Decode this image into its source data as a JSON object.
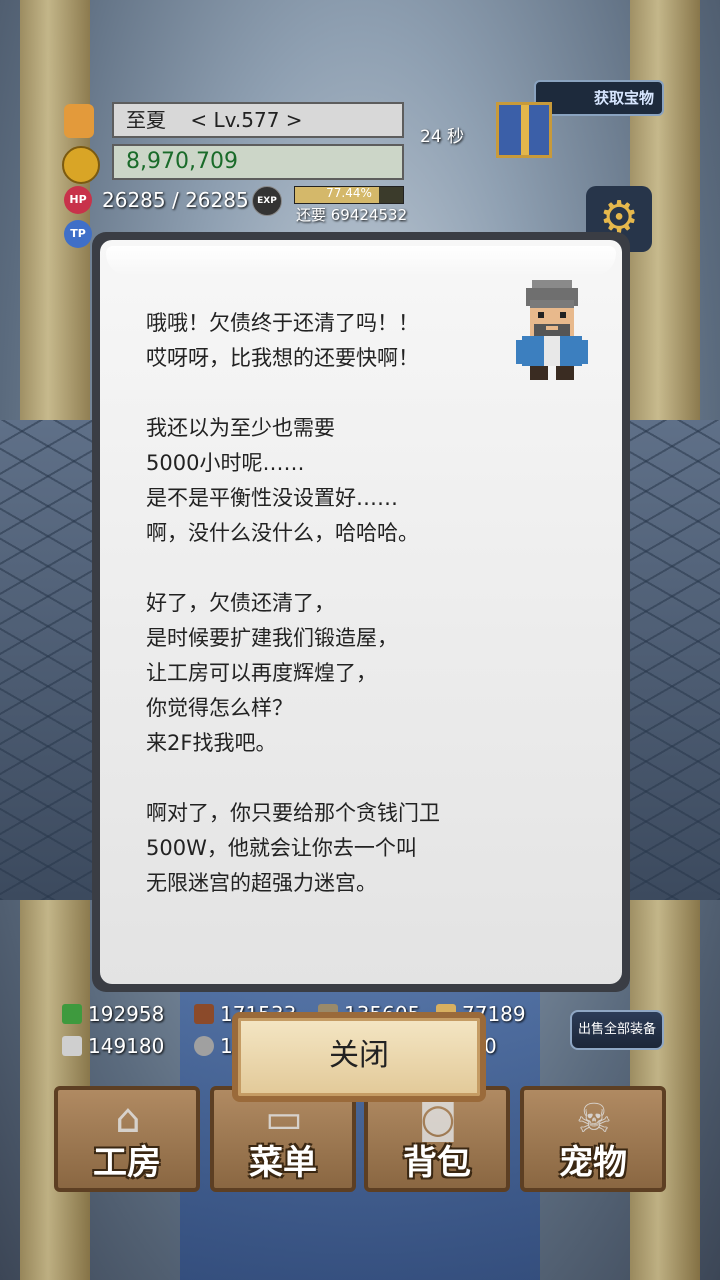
{
  "player": {
    "name": "至夏",
    "level": "< Lv.577 >",
    "gold": "8,970,709"
  },
  "stats": {
    "hp_label": "HP",
    "hp": "26285 / 26285",
    "tp_label": "TP",
    "exp_label": "EXP",
    "exp_percent": "77.44%",
    "exp_fraction": 0.7744,
    "exp_remaining": "还要 69424532"
  },
  "timer": "24 秒",
  "get_gift_label": "获取宝物",
  "dialog": {
    "paragraphs": [
      [
        "哦哦！欠债终于还清了吗！！",
        "哎呀呀，比我想的还要快啊！"
      ],
      [
        "我还以为至少也需要",
        "5000小时呢……",
        "是不是平衡性没设置好……",
        "啊，没什么没什么，哈哈哈。"
      ],
      [
        "好了，欠债还清了，",
        "是时候要扩建我们锻造屋，",
        "让工房可以再度辉煌了，",
        "你觉得怎么样？",
        "来2F找我吧。"
      ],
      [
        "啊对了，你只要给那个贪钱门卫",
        "500W，他就会让你去一个叫",
        "无限迷宫的超强力迷宫。"
      ]
    ]
  },
  "resources": {
    "herb": "192958",
    "wood": "171533",
    "ore": "135605",
    "gem": "77189",
    "iron": "149180",
    "stone": "1",
    "extra": "0"
  },
  "sell_all_label": "出售全部装备",
  "close_label": "关闭",
  "nav": [
    {
      "label": "工房"
    },
    {
      "label": "菜单"
    },
    {
      "label": "背包"
    },
    {
      "label": "宠物"
    }
  ],
  "colors": {
    "gold_text": "#1a6b2a",
    "exp_fill": "#d4b86a",
    "button_frame": "#9a6a3a"
  }
}
